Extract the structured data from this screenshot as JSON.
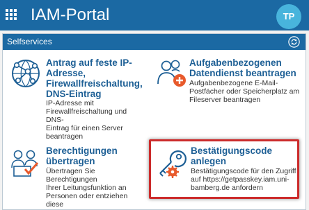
{
  "header": {
    "app_title": "IAM-Portal",
    "avatar_initials": "TP",
    "menu_icon": "apps-grid-icon",
    "bar_color": "#1b69a3",
    "avatar_color": "#48b4dc"
  },
  "panel": {
    "title": "Selfservices",
    "refresh_icon": "refresh-icon"
  },
  "tiles": [
    {
      "icon": "network-globe-icon",
      "title_lines": [
        "Antrag auf feste IP-",
        "Adresse,",
        "Firewallfreischaltung,",
        "DNS-Eintrag"
      ],
      "desc_lines": [
        "IP-Adresse mit",
        "Firewallfreischaltung und DNS-",
        "Eintrag für einen Server",
        "beantragen"
      ]
    },
    {
      "icon": "users-add-icon",
      "title_lines": [
        "Aufgabenbezogenen",
        "Datendienst beantragen"
      ],
      "desc_lines": [
        "Aufgabenbezogene E-Mail-",
        "Postfächer oder Speicherplatz am",
        "Fileserver beantragen"
      ]
    },
    {
      "icon": "users-check-icon",
      "title_lines": [
        "Berechtigungen",
        "übertragen"
      ],
      "desc_lines": [
        "Übertragen Sie Berechtigungen",
        "Ihrer Leitungsfunktion an",
        "Personen oder entziehen diese"
      ]
    },
    {
      "icon": "key-gear-icon",
      "title_lines": [
        "Bestätigungscode",
        "anlegen"
      ],
      "desc_lines": [
        "Bestätigungscode für den Zugriff",
        "auf https://getpasskey.iam.uni-",
        "bamberg.de anfordern"
      ]
    }
  ]
}
